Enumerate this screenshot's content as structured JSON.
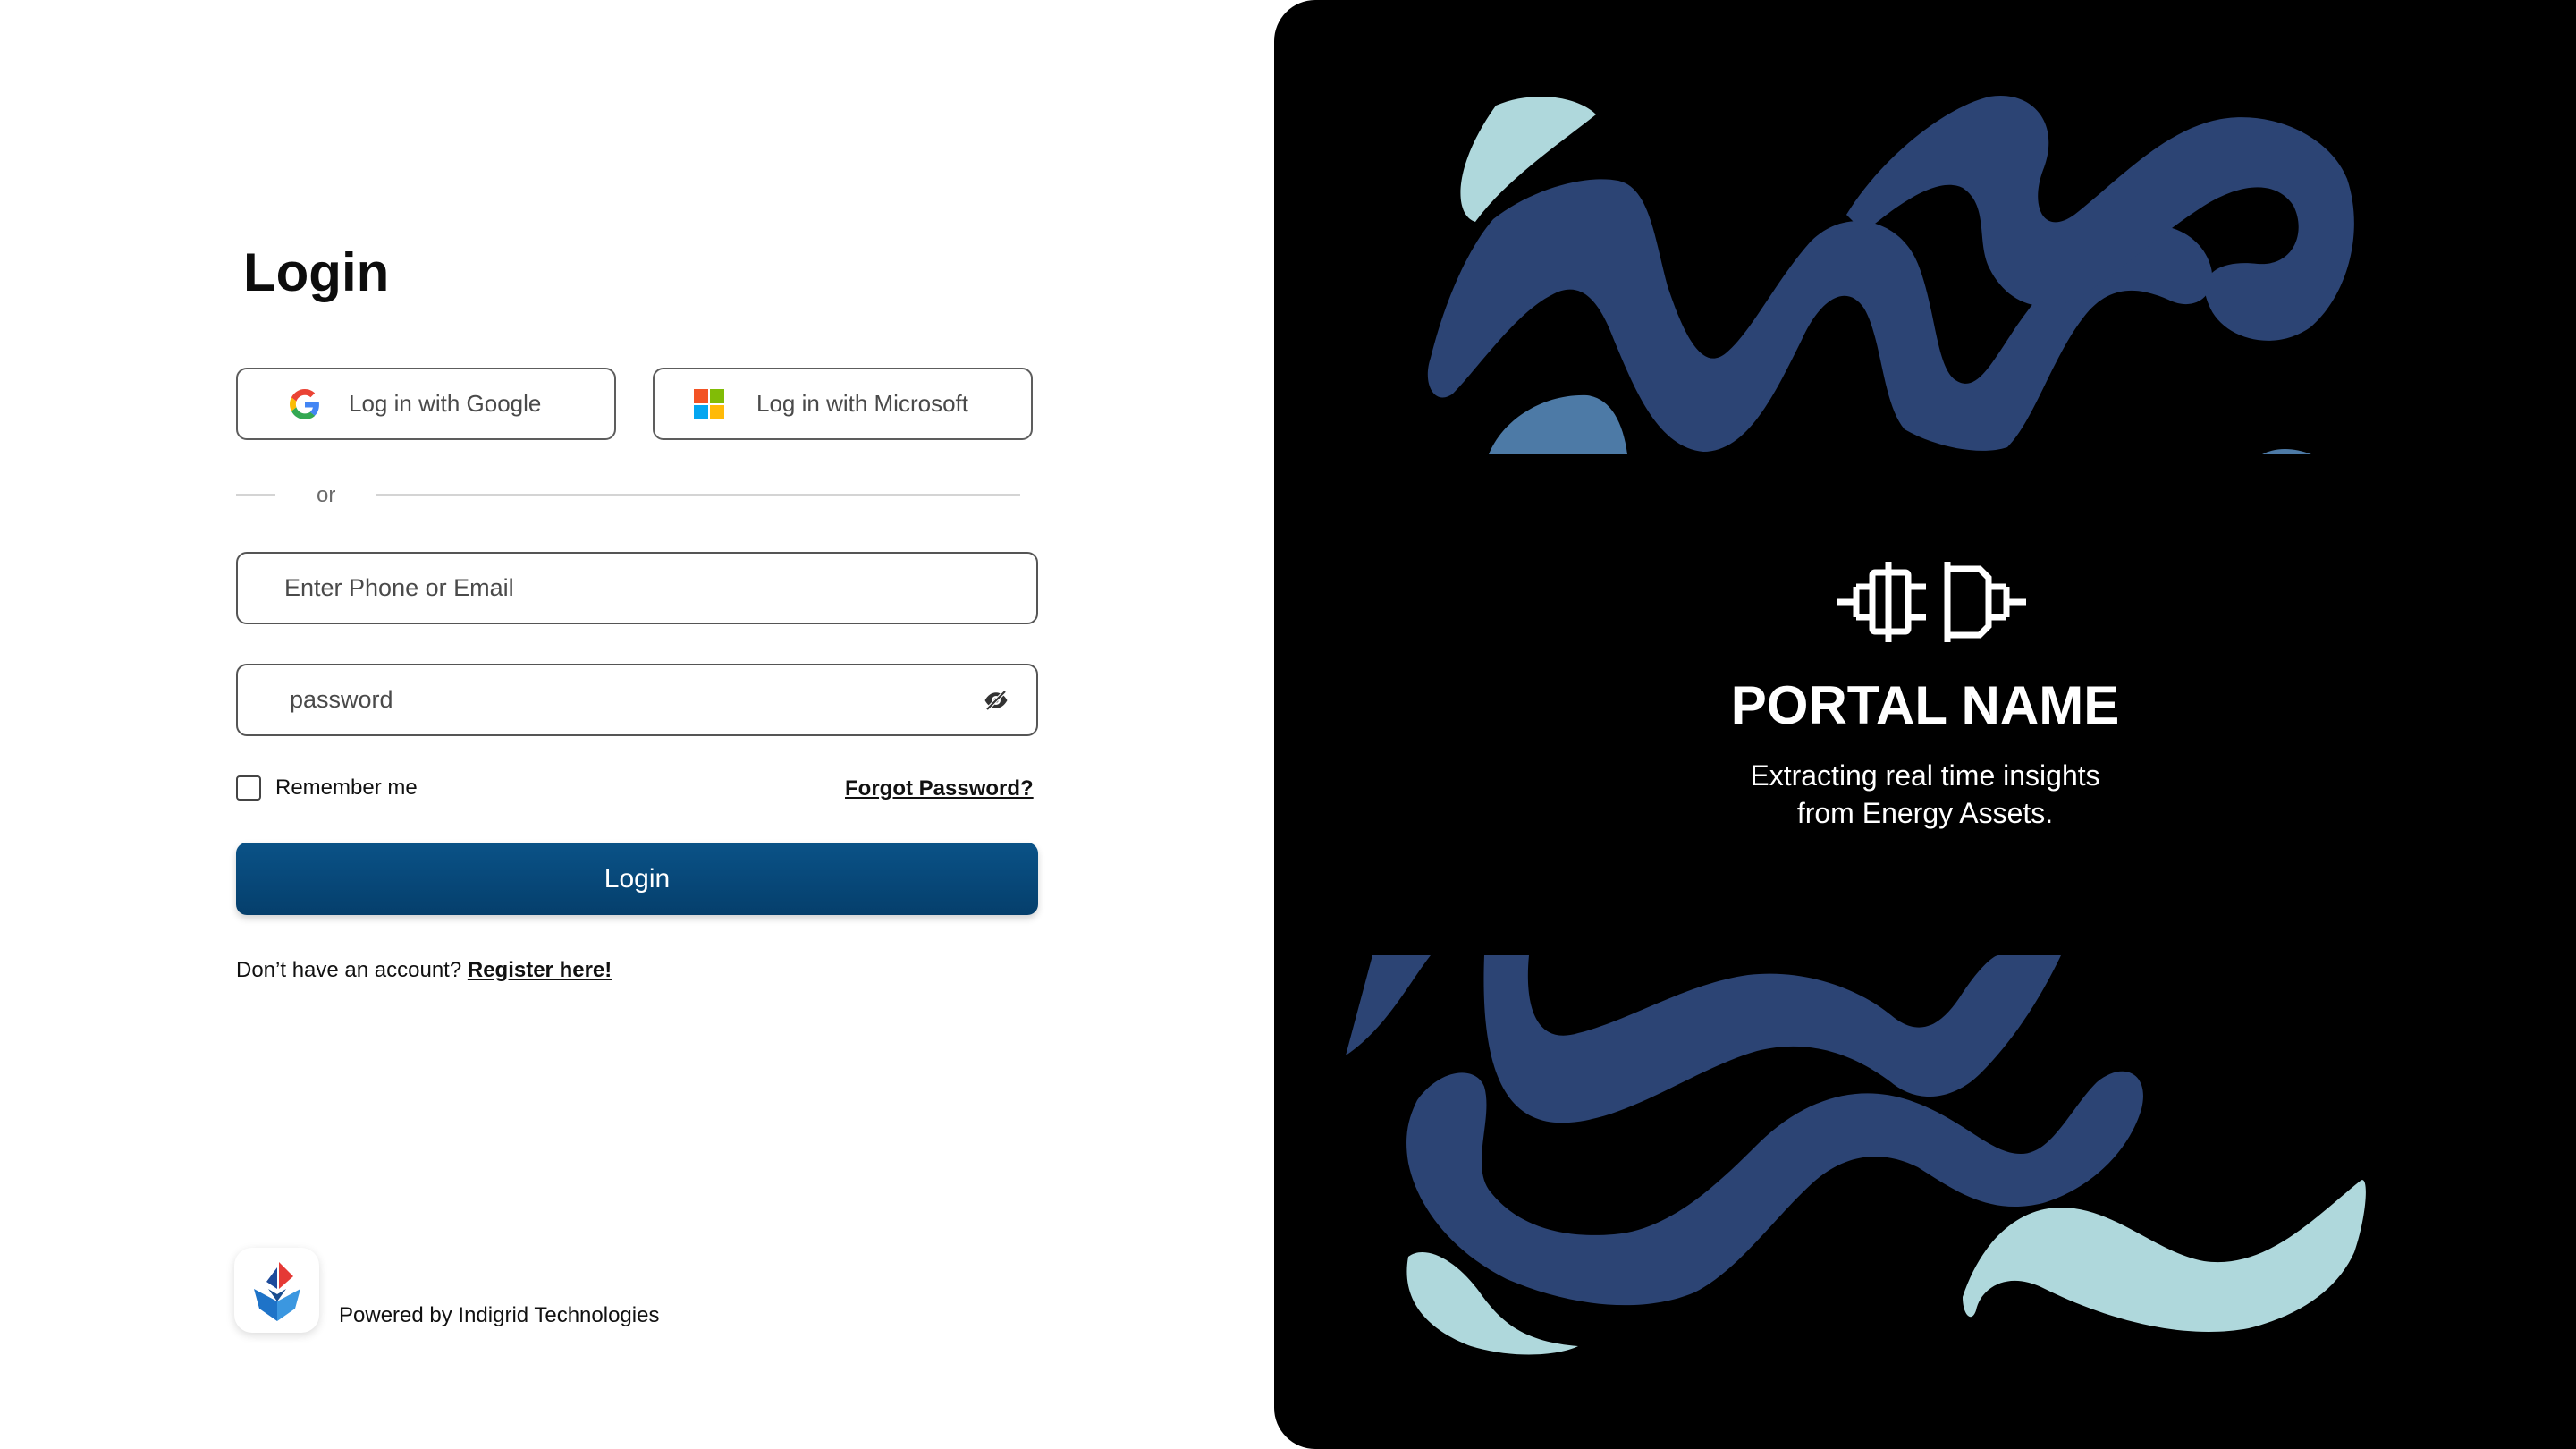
{
  "login": {
    "title": "Login",
    "google_label": "Log in with Google",
    "microsoft_label": "Log in with Microsoft",
    "divider_text": "or",
    "email_placeholder": "Enter Phone or Email",
    "password_placeholder": "password",
    "remember_label": "Remember me",
    "forgot_label": "Forgot Password?",
    "submit_label": "Login",
    "register_prompt": "Don’t have an account?",
    "register_link": "Register here!"
  },
  "footer": {
    "powered_by": "Powered by Indigrid Technologies"
  },
  "hero": {
    "portal_name": "PORTAL NAME",
    "tagline_line1": "Extracting real time insights",
    "tagline_line2": "from Energy Assets."
  },
  "colors": {
    "primary_button": "#0a5287",
    "hero_background": "#000000",
    "wave_dark": "#2c4474",
    "wave_light": "#afd8dc",
    "wave_mid": "#4d7aa6"
  },
  "icons": {
    "google": "google-icon",
    "microsoft": "microsoft-icon",
    "eye_hidden": "eye-off-icon",
    "plug": "plug-connector-icon",
    "brand": "indigrid-logo"
  }
}
